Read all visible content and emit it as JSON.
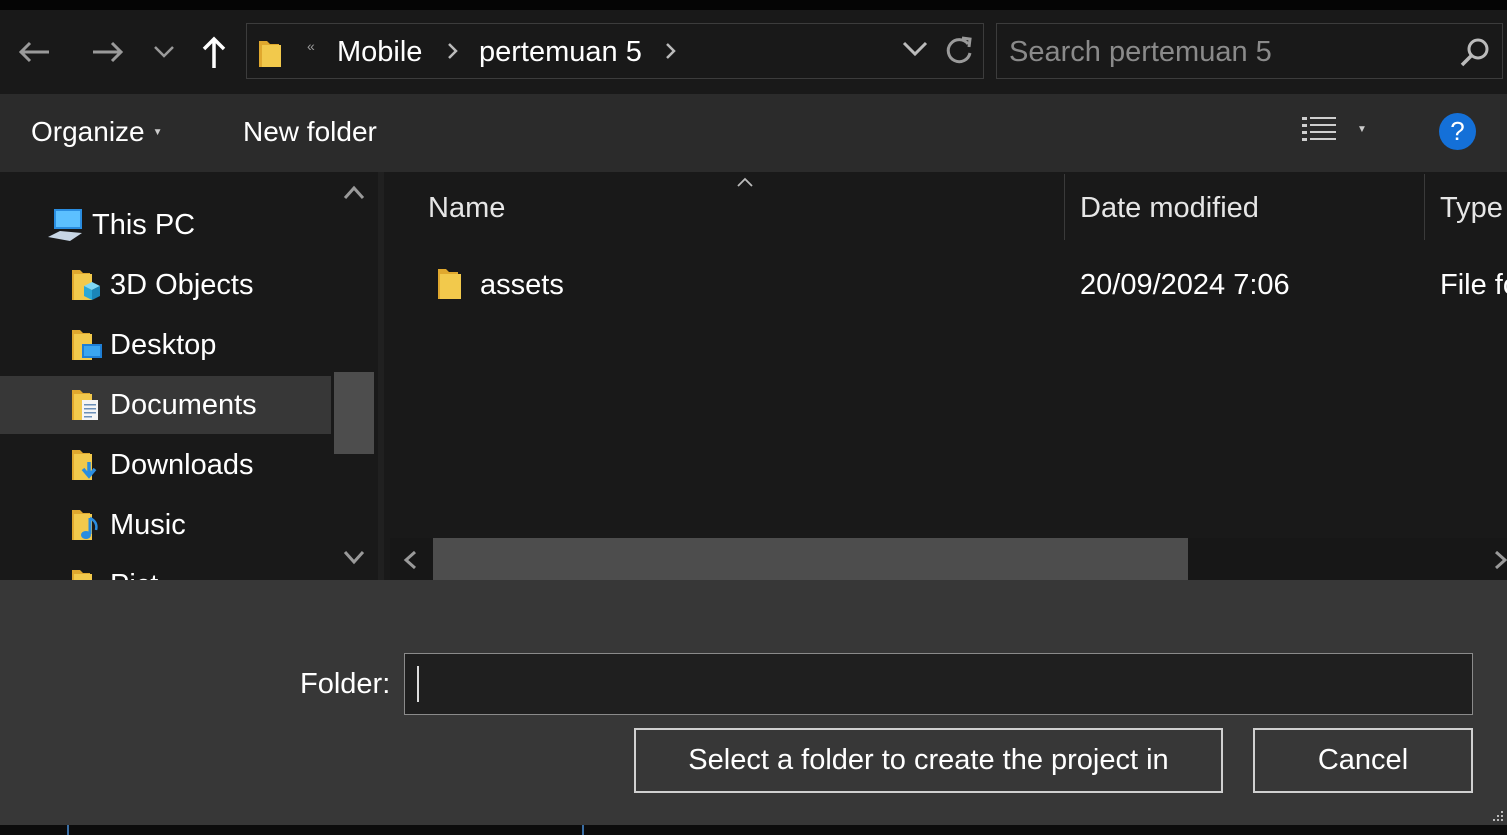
{
  "nav": {
    "back_icon": "arrow-left-icon",
    "forward_icon": "arrow-right-icon",
    "recent_icon": "chevron-down-icon",
    "up_icon": "arrow-up-icon"
  },
  "address": {
    "overflow": "«",
    "crumbs": [
      "Mobile",
      "pertemuan 5"
    ],
    "dropdown_icon": "chevron-down-icon",
    "refresh_icon": "refresh-icon"
  },
  "search": {
    "placeholder": "Search pertemuan 5",
    "icon": "search-icon"
  },
  "toolbar": {
    "organize_label": "Organize",
    "new_folder_label": "New folder",
    "view_icon": "details-view-icon",
    "help_label": "?"
  },
  "tree": {
    "items": [
      {
        "label": "This PC",
        "icon": "computer-icon"
      },
      {
        "label": "3D Objects",
        "icon": "3d-objects-folder-icon"
      },
      {
        "label": "Desktop",
        "icon": "desktop-folder-icon"
      },
      {
        "label": "Documents",
        "icon": "documents-folder-icon",
        "selected": true
      },
      {
        "label": "Downloads",
        "icon": "downloads-folder-icon"
      },
      {
        "label": "Music",
        "icon": "music-folder-icon"
      },
      {
        "label": "Pict",
        "icon": "pictures-folder-icon"
      }
    ]
  },
  "columns": {
    "name": "Name",
    "date": "Date modified",
    "type": "Type"
  },
  "files": [
    {
      "name": "assets",
      "date": "20/09/2024 7:06",
      "type": "File fo"
    }
  ],
  "dialog": {
    "folder_label": "Folder:",
    "folder_value": "",
    "select_button": "Select a folder to create the project in",
    "cancel_button": "Cancel"
  },
  "colors": {
    "accent": "#1470d8",
    "folder_yellow": "#f2c94c",
    "background": "#191919"
  }
}
